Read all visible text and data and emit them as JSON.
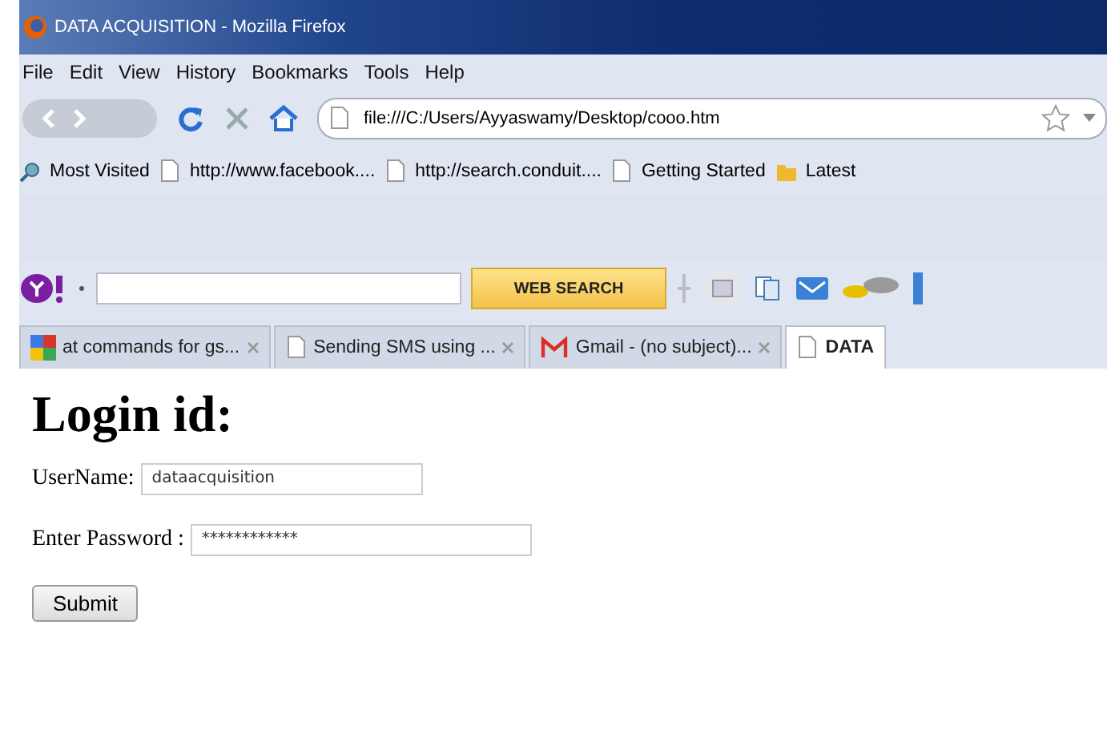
{
  "window": {
    "title": "DATA ACQUISITION - Mozilla Firefox"
  },
  "menu": [
    "File",
    "Edit",
    "View",
    "History",
    "Bookmarks",
    "Tools",
    "Help"
  ],
  "address_bar": {
    "value": "file:///C:/Users/Ayyaswamy/Desktop/cooo.htm"
  },
  "bookmarks": [
    {
      "label": "Most Visited",
      "kind": "search"
    },
    {
      "label": "http://www.facebook....",
      "kind": "page"
    },
    {
      "label": "http://search.conduit....",
      "kind": "page"
    },
    {
      "label": "Getting Started",
      "kind": "page"
    },
    {
      "label": "Latest",
      "kind": "feed"
    }
  ],
  "yahoo_toolbar": {
    "search_button": "WEB SEARCH"
  },
  "tabs": [
    {
      "label": "at commands for gs...",
      "kind": "google",
      "selected": false
    },
    {
      "label": "Sending SMS using ...",
      "kind": "page",
      "selected": false
    },
    {
      "label": "Gmail - (no subject)...",
      "kind": "gmail",
      "selected": false
    },
    {
      "label": "DATA",
      "kind": "page",
      "selected": true
    }
  ],
  "page": {
    "heading": "Login id:",
    "fields": [
      {
        "label": "UserName:",
        "value": "dataacquisition",
        "kind": "text"
      },
      {
        "label": "Enter Password :",
        "value": "************",
        "kind": "password"
      }
    ],
    "submit": "Submit"
  }
}
